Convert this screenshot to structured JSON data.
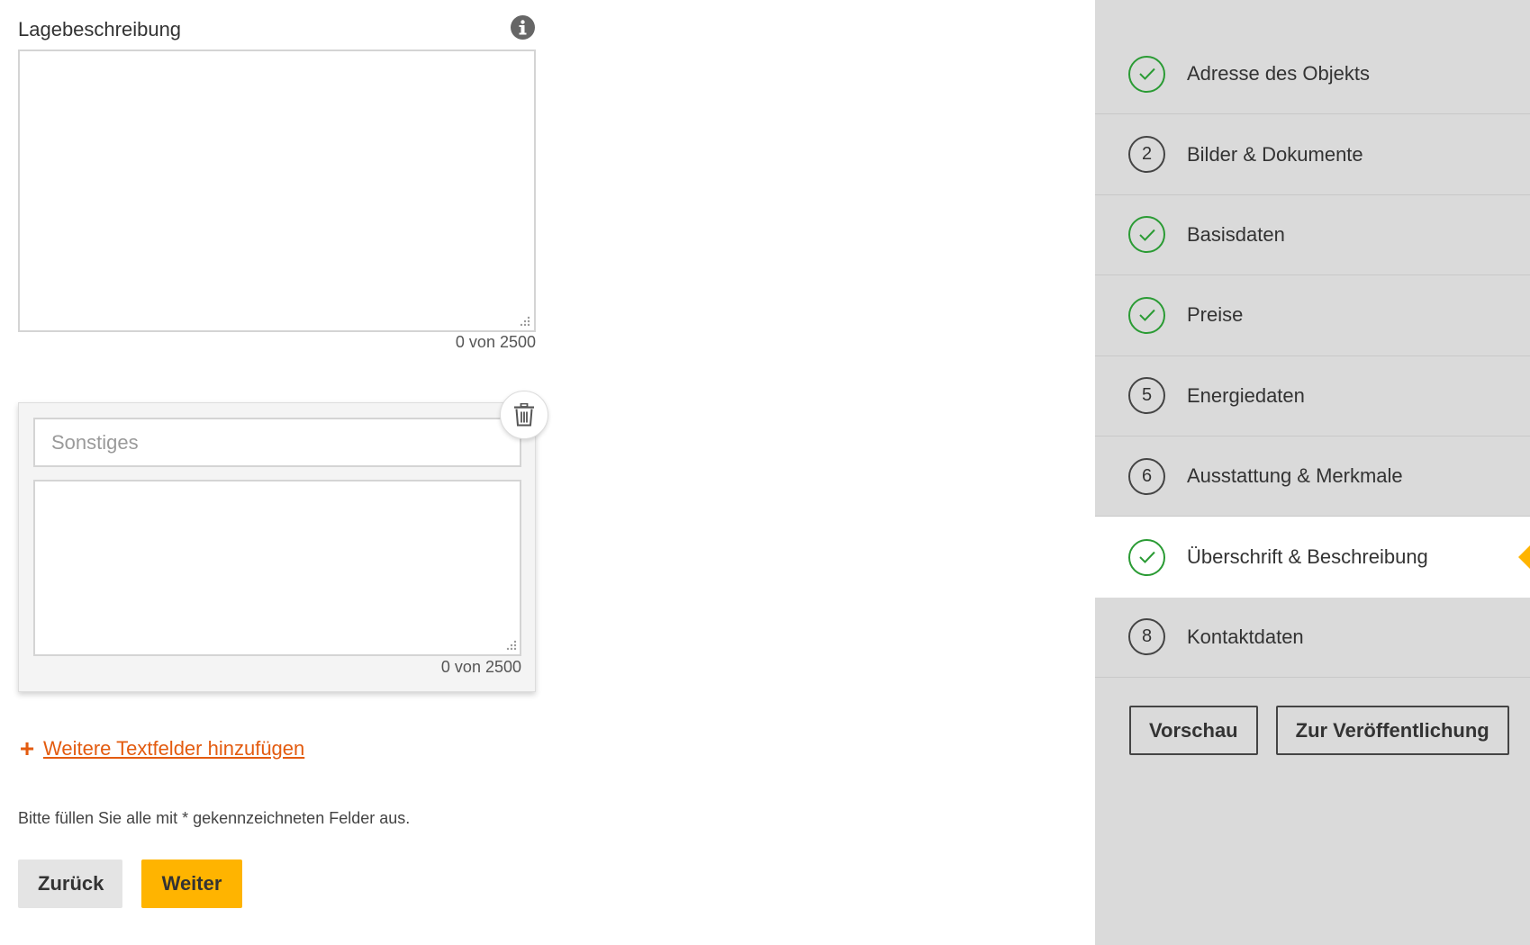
{
  "form": {
    "lage_label": "Lagebeschreibung",
    "lage_value": "",
    "lage_counter": "0 von 2500",
    "extra_title_placeholder": "Sonstiges",
    "extra_title_value": "",
    "extra_text_value": "",
    "extra_counter": "0 von 2500",
    "add_fields_label": "Weitere Textfelder hinzufügen",
    "add_fields_icon": "+",
    "required_hint": "Bitte füllen Sie alle mit * gekennzeichneten Felder aus.",
    "back_label": "Zurück",
    "next_label": "Weiter"
  },
  "sidebar": {
    "steps": [
      {
        "badge": "",
        "label": "Adresse des Objekts",
        "status": "done"
      },
      {
        "badge": "2",
        "label": "Bilder & Dokumente",
        "status": "open"
      },
      {
        "badge": "",
        "label": "Basisdaten",
        "status": "done"
      },
      {
        "badge": "",
        "label": "Preise",
        "status": "done"
      },
      {
        "badge": "5",
        "label": "Energiedaten",
        "status": "open"
      },
      {
        "badge": "6",
        "label": "Ausstattung & Merkmale",
        "status": "open"
      },
      {
        "badge": "",
        "label": "Überschrift & Beschreibung",
        "status": "done-active"
      },
      {
        "badge": "8",
        "label": "Kontaktdaten",
        "status": "open"
      }
    ],
    "preview_label": "Vorschau",
    "publish_label": "Zur Veröffentlichung"
  },
  "colors": {
    "accent": "#ffb400",
    "link": "#e35b0f",
    "done": "#2a9b34",
    "sidebar_bg": "#dadada"
  },
  "icons": {
    "info": "info-icon",
    "trash": "trash-icon",
    "check": "check-icon",
    "plus": "plus-icon"
  }
}
